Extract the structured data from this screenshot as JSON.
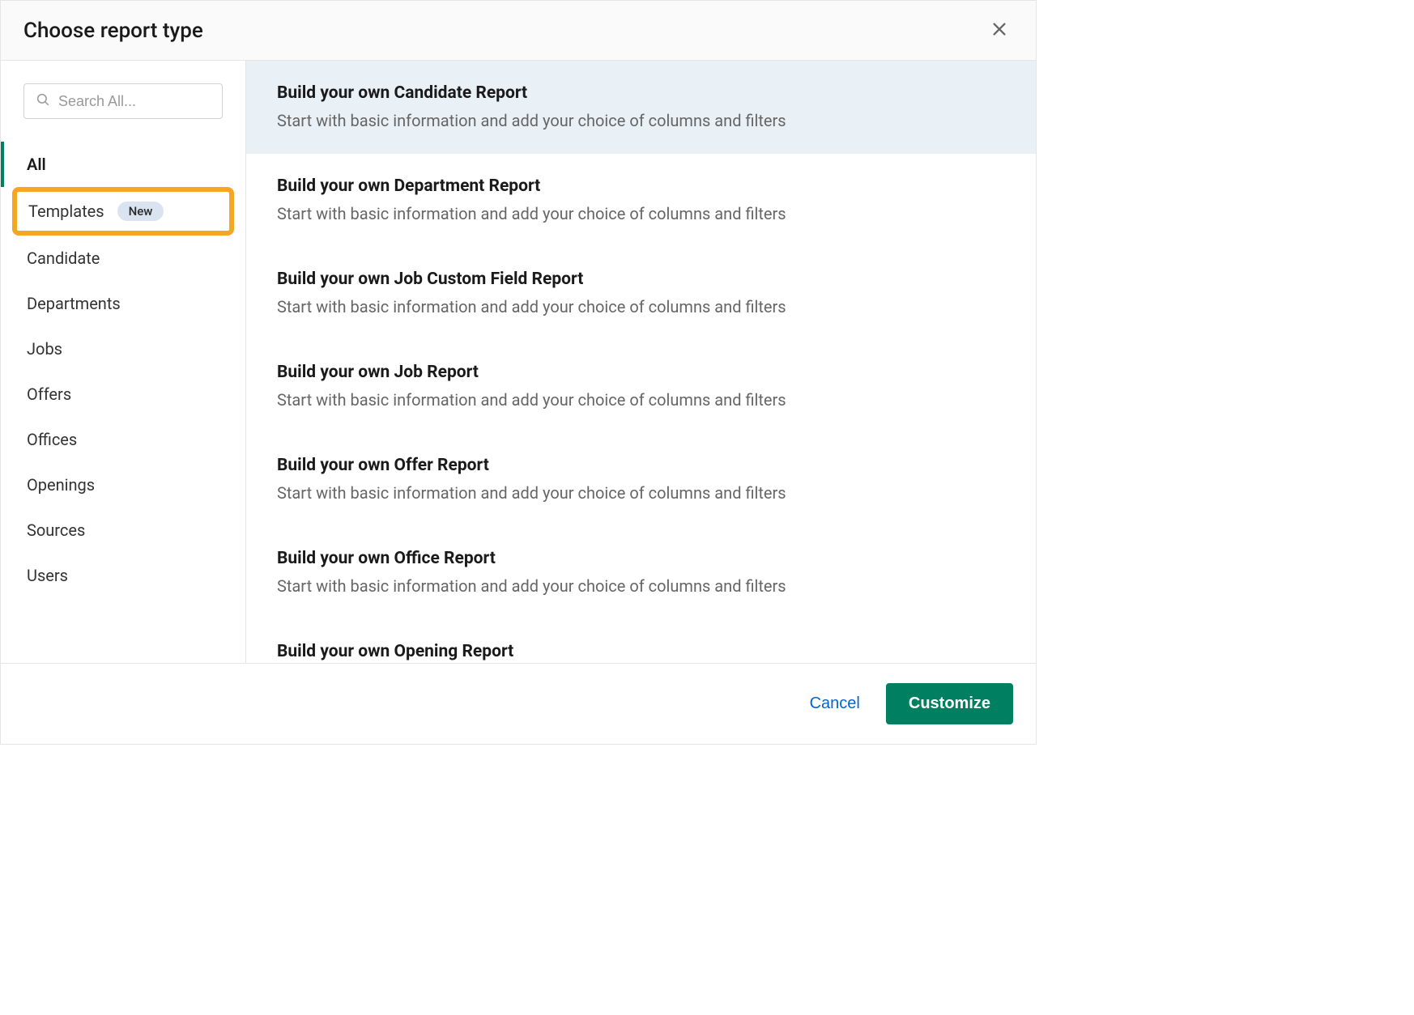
{
  "header": {
    "title": "Choose report type"
  },
  "search": {
    "placeholder": "Search All..."
  },
  "sidebar": {
    "items": [
      {
        "label": "All",
        "active": true
      },
      {
        "label": "Templates",
        "badge": "New",
        "highlighted": true
      },
      {
        "label": "Candidate"
      },
      {
        "label": "Departments"
      },
      {
        "label": "Jobs"
      },
      {
        "label": "Offers"
      },
      {
        "label": "Offices"
      },
      {
        "label": "Openings"
      },
      {
        "label": "Sources"
      },
      {
        "label": "Users"
      }
    ]
  },
  "reports": [
    {
      "title": "Build your own Candidate Report",
      "description": "Start with basic information and add your choice of columns and filters",
      "selected": true
    },
    {
      "title": "Build your own Department Report",
      "description": "Start with basic information and add your choice of columns and filters"
    },
    {
      "title": "Build your own Job Custom Field Report",
      "description": "Start with basic information and add your choice of columns and filters"
    },
    {
      "title": "Build your own Job Report",
      "description": "Start with basic information and add your choice of columns and filters"
    },
    {
      "title": "Build your own Offer Report",
      "description": "Start with basic information and add your choice of columns and filters"
    },
    {
      "title": "Build your own Office Report",
      "description": "Start with basic information and add your choice of columns and filters"
    },
    {
      "title": "Build your own Opening Report",
      "description": ""
    }
  ],
  "footer": {
    "cancel": "Cancel",
    "customize": "Customize"
  }
}
